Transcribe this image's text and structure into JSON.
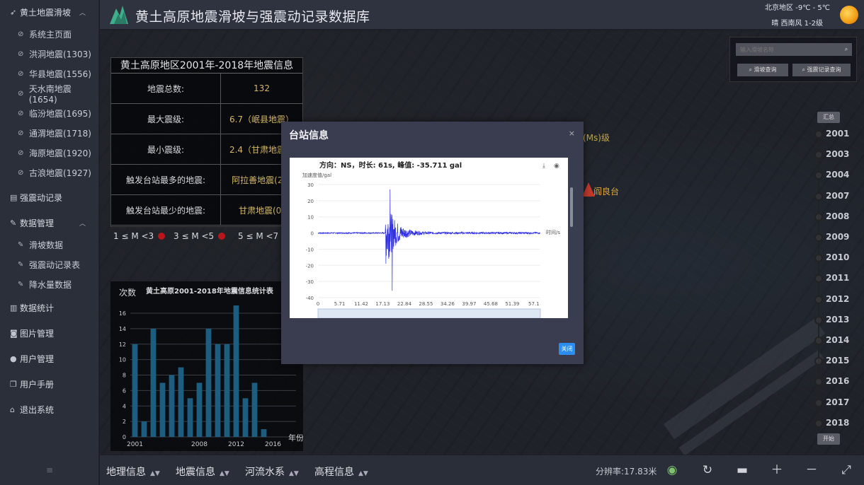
{
  "header": {
    "title": "黄土高原地震滑坡与强震动记录数据库",
    "weather_location": "北京地区  -9℃ - 5℃",
    "weather_condition": "晴    西南风 1-2级"
  },
  "sidebar": {
    "group1": {
      "label": "黄土地震滑坡",
      "icon": "send-icon"
    },
    "group1_items": [
      {
        "label": "系统主页面"
      },
      {
        "label": "洪洞地震(1303)"
      },
      {
        "label": "华县地震(1556)"
      },
      {
        "label": "天水南地震(1654)"
      },
      {
        "label": "临汾地震(1695)"
      },
      {
        "label": "通渭地震(1718)"
      },
      {
        "label": "海原地震(1920)"
      },
      {
        "label": "古浪地震(1927)"
      }
    ],
    "group2": {
      "label": "强震动记录"
    },
    "group3": {
      "label": "数据管理"
    },
    "group3_items": [
      {
        "label": "滑坡数据"
      },
      {
        "label": "强震动记录表"
      },
      {
        "label": "降水量数据"
      }
    ],
    "group4": {
      "label": "数据统计"
    },
    "group5": {
      "label": "图片管理"
    },
    "group6": {
      "label": "用户管理"
    },
    "group7": {
      "label": "用户手册"
    },
    "group8": {
      "label": "退出系统"
    },
    "collapse_glyph": "≡"
  },
  "info_panel": {
    "title": "黄土高原地区2001年-2018年地震信息",
    "rows": [
      {
        "key": "地震总数:",
        "value": "132"
      },
      {
        "key": "最大震级:",
        "value": "6.7（岷县地震）"
      },
      {
        "key": "最小震级:",
        "value": "2.4（甘肃地震）"
      },
      {
        "key": "触发台站最多的地震:",
        "value": "阿拉善地震(23)"
      },
      {
        "key": "触发台站最少的地震:",
        "value": "甘肃地震(0)"
      }
    ]
  },
  "legend": {
    "items": [
      {
        "label": "1 ≤ M <3"
      },
      {
        "label": "3 ≤ M <5"
      },
      {
        "label": "5 ≤ M <7"
      }
    ]
  },
  "stats_chart": {
    "chart_data": {
      "type": "bar",
      "title": "黄土高原2001-2018年地震信息统计表",
      "ylabel": "次数",
      "xlabel": "年份",
      "categories": [
        "2001",
        "2002",
        "2003",
        "2004",
        "2005",
        "2006",
        "2007",
        "2008",
        "2009",
        "2010",
        "2011",
        "2012",
        "2013",
        "2014",
        "2015",
        "2016",
        "2017",
        "2018"
      ],
      "values": [
        12,
        2,
        14,
        7,
        8,
        9,
        5,
        7,
        14,
        12,
        12,
        17,
        5,
        7,
        1,
        0,
        0,
        0
      ],
      "xticks": [
        "2001",
        "2008",
        "2012",
        "2016"
      ],
      "yticks": [
        0,
        2,
        4,
        6,
        8,
        10,
        12,
        14,
        16
      ],
      "ylim": [
        0,
        16
      ],
      "bar_color": "#1d5d80"
    }
  },
  "search_panel": {
    "placeholder": "输入滑坡名称",
    "btn1": "滑坡查询",
    "btn2": "强震记录查询"
  },
  "timeline": {
    "top_button": "汇总",
    "bottom_button": "开始",
    "years": [
      "2001",
      "2003",
      "2004",
      "2007",
      "2008",
      "2009",
      "2010",
      "2011",
      "2012",
      "2013",
      "2014",
      "2015",
      "2016",
      "2017",
      "2018"
    ]
  },
  "map": {
    "label1": "(Ms)级",
    "label2": "阎良台"
  },
  "bottombar": {
    "menus": [
      "地理信息",
      "地震信息",
      "河流水系",
      "高程信息"
    ],
    "scale": "分辨率:17.83米"
  },
  "modal": {
    "title": "台站信息",
    "close_x": "×",
    "close_button": "关闭",
    "chart_data": {
      "type": "line",
      "title": "方向：NS，时长: 61s, 峰值: -35.711 gal",
      "ylabel": "加速度值/gal",
      "xlabel": "时间/s",
      "ylim": [
        -40,
        30
      ],
      "yticks": [
        30,
        20,
        10,
        0,
        -10,
        -20,
        -30,
        -40
      ],
      "xticks": [
        "0",
        "5.71",
        "11.42",
        "17.13",
        "22.84",
        "28.55",
        "34.26",
        "39.97",
        "45.68",
        "51.39",
        "57.1"
      ],
      "peak_value": -35.711,
      "duration_s": 61,
      "line_color": "#2f2fe6"
    }
  }
}
